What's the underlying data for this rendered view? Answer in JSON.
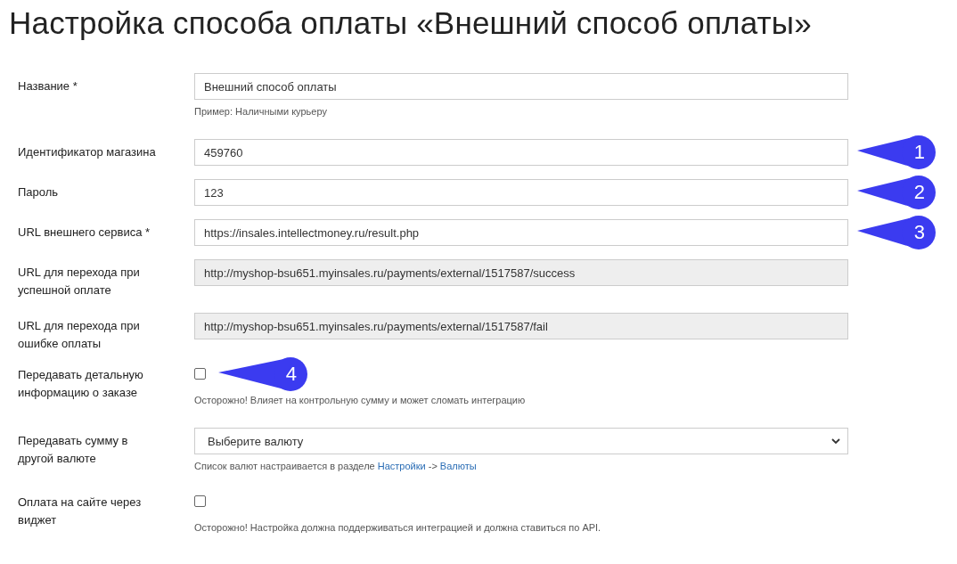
{
  "title": "Настройка способа оплаты «Внешний способ оплаты»",
  "rows": [
    {
      "kind": "input",
      "label": "Название *",
      "value": "Внешний способ оплаты",
      "readonly": false,
      "hint": [
        {
          "text": "Пример: Наличными курьеру",
          "link": false
        }
      ]
    },
    {
      "kind": "input",
      "label": "Идентификатор магазина",
      "value": "459760",
      "readonly": false,
      "callout": "1"
    },
    {
      "kind": "input",
      "label": "Пароль",
      "value": "123",
      "readonly": false,
      "callout": "2"
    },
    {
      "kind": "input",
      "label": "URL внешнего сервиса *",
      "value": "https://insales.intellectmoney.ru/result.php",
      "readonly": false,
      "callout": "3"
    },
    {
      "kind": "input",
      "label": "URL для перехода при успешной оплате",
      "value": "http://myshop-bsu651.myinsales.ru/payments/external/1517587/success",
      "readonly": true
    },
    {
      "kind": "input",
      "label": "URL для перехода при ошибке оплаты",
      "value": "http://myshop-bsu651.myinsales.ru/payments/external/1517587/fail",
      "readonly": true
    },
    {
      "kind": "checkbox",
      "label": "Передавать детальную информацию о заказе",
      "checked": false,
      "callout": "4",
      "hint": [
        {
          "text": "Осторожно! Влияет на контрольную сумму и может сломать интеграцию",
          "link": false
        }
      ]
    },
    {
      "kind": "select",
      "label": "Передавать сумму в другой валюте",
      "value": "Выберите валюту",
      "hint": [
        {
          "text": "Список валют настраивается в разделе ",
          "link": false
        },
        {
          "text": "Настройки",
          "link": true
        },
        {
          "text": " -> ",
          "link": false
        },
        {
          "text": "Валюты",
          "link": true
        }
      ]
    },
    {
      "kind": "checkbox",
      "label": "Оплата на сайте через виджет",
      "checked": false,
      "hint": [
        {
          "text": "Осторожно! Настройка должна поддерживаться интеграцией и должна ставиться по API.",
          "link": false
        }
      ]
    }
  ]
}
